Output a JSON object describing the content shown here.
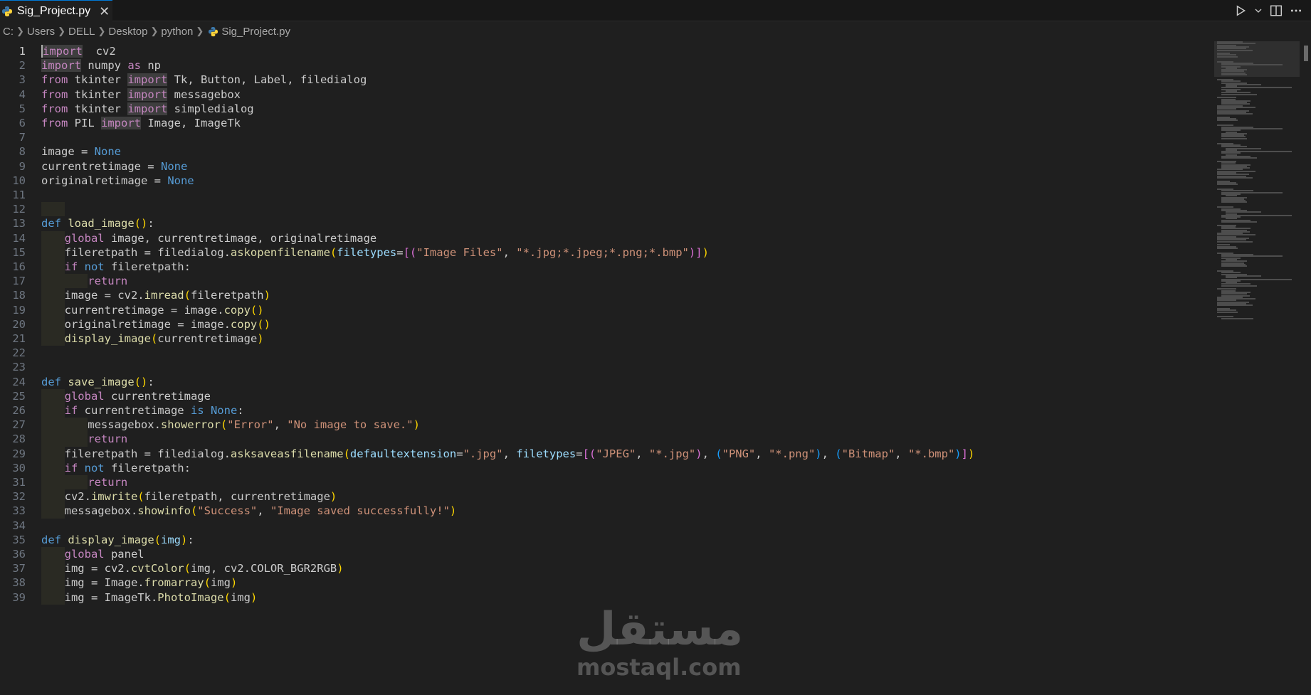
{
  "tab": {
    "label": "Sig_Project.py",
    "close_glyph": "✕"
  },
  "breadcrumb": [
    "C:",
    "Users",
    "DELL",
    "Desktop",
    "python",
    "Sig_Project.py"
  ],
  "colors": {
    "keyword": "#c586c0",
    "blue_keyword": "#569cd6",
    "function": "#dcdcaa",
    "string": "#ce9178",
    "parameter": "#9cdcfe",
    "accent": "#0078d4"
  },
  "code_lines": [
    {
      "n": 1,
      "tokens": [
        [
          "kw-hl",
          "import"
        ],
        [
          "",
          "  cv2"
        ]
      ]
    },
    {
      "n": 2,
      "tokens": [
        [
          "kw-hl",
          "import"
        ],
        [
          "",
          " numpy "
        ],
        [
          "kw",
          "as"
        ],
        [
          "",
          " np"
        ]
      ]
    },
    {
      "n": 3,
      "tokens": [
        [
          "kw",
          "from"
        ],
        [
          "",
          " tkinter "
        ],
        [
          "kw-hl",
          "import"
        ],
        [
          "",
          " Tk, Button, Label, filedialog"
        ]
      ]
    },
    {
      "n": 4,
      "tokens": [
        [
          "kw",
          "from"
        ],
        [
          "",
          " tkinter "
        ],
        [
          "kw-hl",
          "import"
        ],
        [
          "",
          " messagebox"
        ]
      ]
    },
    {
      "n": 5,
      "tokens": [
        [
          "kw",
          "from"
        ],
        [
          "",
          " tkinter "
        ],
        [
          "kw-hl",
          "import"
        ],
        [
          "",
          " simpledialog"
        ]
      ]
    },
    {
      "n": 6,
      "tokens": [
        [
          "kw",
          "from"
        ],
        [
          "",
          " PIL "
        ],
        [
          "kw-hl",
          "import"
        ],
        [
          "",
          " Image, ImageTk"
        ]
      ]
    },
    {
      "n": 7,
      "tokens": []
    },
    {
      "n": 8,
      "tokens": [
        [
          "",
          "image = "
        ],
        [
          "blue",
          "None"
        ]
      ]
    },
    {
      "n": 9,
      "tokens": [
        [
          "",
          "currentretimage = "
        ],
        [
          "blue",
          "None"
        ]
      ]
    },
    {
      "n": 10,
      "tokens": [
        [
          "",
          "originalretimage = "
        ],
        [
          "blue",
          "None"
        ]
      ]
    },
    {
      "n": 11,
      "tokens": []
    },
    {
      "n": 12,
      "tokens": []
    },
    {
      "n": 13,
      "tokens": [
        [
          "blue",
          "def"
        ],
        [
          "",
          " "
        ],
        [
          "fn",
          "load_image"
        ],
        [
          "paren",
          "()"
        ],
        [
          "",
          ":"
        ]
      ]
    },
    {
      "n": 14,
      "tokens": [
        [
          "",
          ""
        ],
        [
          "kw",
          "global"
        ],
        [
          "",
          " image, currentretimage, originalretimage"
        ]
      ]
    },
    {
      "n": 15,
      "tokens": [
        [
          "",
          ""
        ],
        [
          "",
          "fileretpath = filedialog."
        ],
        [
          "fn",
          "askopenfilename"
        ],
        [
          "paren",
          "("
        ],
        [
          "param",
          "filetypes"
        ],
        [
          "",
          "="
        ],
        [
          "bracket",
          "[("
        ],
        [
          "str",
          "\"Image Files\""
        ],
        [
          "",
          ", "
        ],
        [
          "str",
          "\"*.jpg;*.jpeg;*.png;*.bmp\""
        ],
        [
          "bracket",
          ")]"
        ],
        [
          "paren",
          ")"
        ]
      ]
    },
    {
      "n": 16,
      "tokens": [
        [
          "",
          ""
        ],
        [
          "kw",
          "if"
        ],
        [
          "",
          " "
        ],
        [
          "blue",
          "not"
        ],
        [
          "",
          " fileretpath:"
        ]
      ]
    },
    {
      "n": 17,
      "tokens": [
        [
          "",
          ""
        ],
        [
          "kw",
          "return"
        ]
      ]
    },
    {
      "n": 18,
      "tokens": [
        [
          "",
          ""
        ],
        [
          "",
          "image = cv2."
        ],
        [
          "fn",
          "imread"
        ],
        [
          "paren",
          "("
        ],
        [
          "",
          "fileretpath"
        ],
        [
          "paren",
          ")"
        ]
      ]
    },
    {
      "n": 19,
      "tokens": [
        [
          "",
          ""
        ],
        [
          "",
          "currentretimage = image."
        ],
        [
          "fn",
          "copy"
        ],
        [
          "paren",
          "()"
        ]
      ]
    },
    {
      "n": 20,
      "tokens": [
        [
          "",
          ""
        ],
        [
          "",
          "originalretimage = image."
        ],
        [
          "fn",
          "copy"
        ],
        [
          "paren",
          "()"
        ]
      ]
    },
    {
      "n": 21,
      "tokens": [
        [
          "",
          ""
        ],
        [
          "fn",
          "display_image"
        ],
        [
          "paren",
          "("
        ],
        [
          "",
          "currentretimage"
        ],
        [
          "paren",
          ")"
        ]
      ]
    },
    {
      "n": 22,
      "tokens": []
    },
    {
      "n": 23,
      "tokens": []
    },
    {
      "n": 24,
      "tokens": [
        [
          "blue",
          "def"
        ],
        [
          "",
          " "
        ],
        [
          "fn",
          "save_image"
        ],
        [
          "paren",
          "()"
        ],
        [
          "",
          ":"
        ]
      ]
    },
    {
      "n": 25,
      "tokens": [
        [
          "",
          ""
        ],
        [
          "kw",
          "global"
        ],
        [
          "",
          " currentretimage"
        ]
      ]
    },
    {
      "n": 26,
      "tokens": [
        [
          "",
          ""
        ],
        [
          "kw",
          "if"
        ],
        [
          "",
          " currentretimage "
        ],
        [
          "blue",
          "is"
        ],
        [
          "",
          " "
        ],
        [
          "blue",
          "None"
        ],
        [
          "",
          ":"
        ]
      ]
    },
    {
      "n": 27,
      "tokens": [
        [
          "",
          ""
        ],
        [
          "",
          "messagebox."
        ],
        [
          "fn",
          "showerror"
        ],
        [
          "paren",
          "("
        ],
        [
          "str",
          "\"Error\""
        ],
        [
          "",
          ", "
        ],
        [
          "str",
          "\"No image to save.\""
        ],
        [
          "paren",
          ")"
        ]
      ]
    },
    {
      "n": 28,
      "tokens": [
        [
          "",
          ""
        ],
        [
          "kw",
          "return"
        ]
      ]
    },
    {
      "n": 29,
      "tokens": [
        [
          "",
          ""
        ],
        [
          "",
          "fileretpath = filedialog."
        ],
        [
          "fn",
          "asksaveasfilename"
        ],
        [
          "paren",
          "("
        ],
        [
          "param",
          "defaultextension"
        ],
        [
          "",
          "="
        ],
        [
          "str",
          "\".jpg\""
        ],
        [
          "",
          ", "
        ],
        [
          "param",
          "filetypes"
        ],
        [
          "",
          "="
        ],
        [
          "bracket",
          "[("
        ],
        [
          "str",
          "\"JPEG\""
        ],
        [
          "",
          ", "
        ],
        [
          "str",
          "\"*.jpg\""
        ],
        [
          "bracket",
          ")"
        ],
        [
          "",
          ", "
        ],
        [
          "paren2",
          "("
        ],
        [
          "str",
          "\"PNG\""
        ],
        [
          "",
          ", "
        ],
        [
          "str",
          "\"*.png\""
        ],
        [
          "paren2",
          ")"
        ],
        [
          "",
          ", "
        ],
        [
          "paren2",
          "("
        ],
        [
          "str",
          "\"Bitmap\""
        ],
        [
          "",
          ", "
        ],
        [
          "str",
          "\"*.bmp\""
        ],
        [
          "paren2",
          ")"
        ],
        [
          "bracket",
          "]"
        ],
        [
          "paren",
          ")"
        ]
      ]
    },
    {
      "n": 30,
      "tokens": [
        [
          "",
          ""
        ],
        [
          "kw",
          "if"
        ],
        [
          "",
          " "
        ],
        [
          "blue",
          "not"
        ],
        [
          "",
          " fileretpath:"
        ]
      ]
    },
    {
      "n": 31,
      "tokens": [
        [
          "",
          ""
        ],
        [
          "kw",
          "return"
        ]
      ]
    },
    {
      "n": 32,
      "tokens": [
        [
          "",
          ""
        ],
        [
          "",
          "cv2."
        ],
        [
          "fn",
          "imwrite"
        ],
        [
          "paren",
          "("
        ],
        [
          "",
          "fileretpath, currentretimage"
        ],
        [
          "paren",
          ")"
        ]
      ]
    },
    {
      "n": 33,
      "tokens": [
        [
          "",
          ""
        ],
        [
          "",
          "messagebox."
        ],
        [
          "fn",
          "showinfo"
        ],
        [
          "paren",
          "("
        ],
        [
          "str",
          "\"Success\""
        ],
        [
          "",
          ", "
        ],
        [
          "str",
          "\"Image saved successfully!\""
        ],
        [
          "paren",
          ")"
        ]
      ]
    },
    {
      "n": 34,
      "tokens": []
    },
    {
      "n": 35,
      "tokens": [
        [
          "blue",
          "def"
        ],
        [
          "",
          " "
        ],
        [
          "fn",
          "display_image"
        ],
        [
          "paren",
          "("
        ],
        [
          "param",
          "img"
        ],
        [
          "paren",
          ")"
        ],
        [
          "",
          ":"
        ]
      ]
    },
    {
      "n": 36,
      "tokens": [
        [
          "",
          ""
        ],
        [
          "kw",
          "global"
        ],
        [
          "",
          " panel"
        ]
      ]
    },
    {
      "n": 37,
      "tokens": [
        [
          "",
          ""
        ],
        [
          "",
          "img = cv2."
        ],
        [
          "fn",
          "cvtColor"
        ],
        [
          "paren",
          "("
        ],
        [
          "",
          "img, cv2.COLOR_BGR2RGB"
        ],
        [
          "paren",
          ")"
        ]
      ]
    },
    {
      "n": 38,
      "tokens": [
        [
          "",
          ""
        ],
        [
          "",
          "img = Image."
        ],
        [
          "fn",
          "fromarray"
        ],
        [
          "paren",
          "("
        ],
        [
          "",
          "img"
        ],
        [
          "paren",
          ")"
        ]
      ]
    },
    {
      "n": 39,
      "tokens": [
        [
          "",
          ""
        ],
        [
          "",
          "img = ImageTk."
        ],
        [
          "fn",
          "PhotoImage"
        ],
        [
          "paren",
          "("
        ],
        [
          "",
          "img"
        ],
        [
          "paren",
          ")"
        ]
      ]
    }
  ],
  "indent_levels": {
    "14": 1,
    "15": 1,
    "16": 1,
    "17": 2,
    "18": 1,
    "19": 1,
    "20": 1,
    "21": 1,
    "25": 1,
    "26": 1,
    "27": 2,
    "28": 2,
    "29": 1,
    "30": 1,
    "31": 2,
    "32": 1,
    "33": 1,
    "36": 1,
    "37": 1,
    "38": 1,
    "39": 1,
    "12": 1
  },
  "watermark": {
    "arabic": "مستقل",
    "latin": "mostaql.com"
  }
}
